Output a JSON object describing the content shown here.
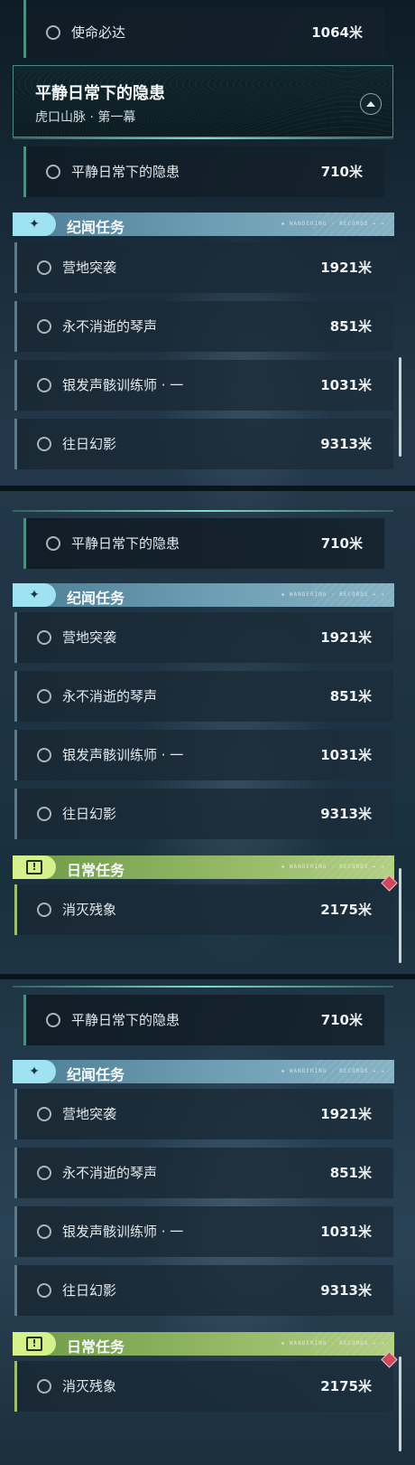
{
  "top_item": {
    "label": "使命必达",
    "distance": "1064米"
  },
  "header": {
    "title": "平静日常下的隐患",
    "subtitle": "虎口山脉 · 第一幕",
    "collapse_icon": "chevron-up-icon"
  },
  "main_quest": {
    "label": "平静日常下的隐患",
    "distance": "710米"
  },
  "category_story": {
    "title": "纪闻任务",
    "icon": "sparkle-icon",
    "tag": "◈ WANDERING · RECORDS ✦ ✦",
    "color": "#9fe3f2"
  },
  "story_quests": [
    {
      "label": "营地突袭",
      "distance": "1921米"
    },
    {
      "label": "永不消逝的琴声",
      "distance": "851米"
    },
    {
      "label": "银发声骸训练师 · 一",
      "distance": "1031米"
    },
    {
      "label": "往日幻影",
      "distance": "9313米"
    }
  ],
  "category_daily": {
    "title": "日常任务",
    "icon": "exclamation-icon",
    "tag": "◈ WANDERING · RECORDS ✦ ✦",
    "color": "#d6f08c"
  },
  "daily_quests": [
    {
      "label": "消灭残象",
      "distance": "2175米"
    }
  ]
}
